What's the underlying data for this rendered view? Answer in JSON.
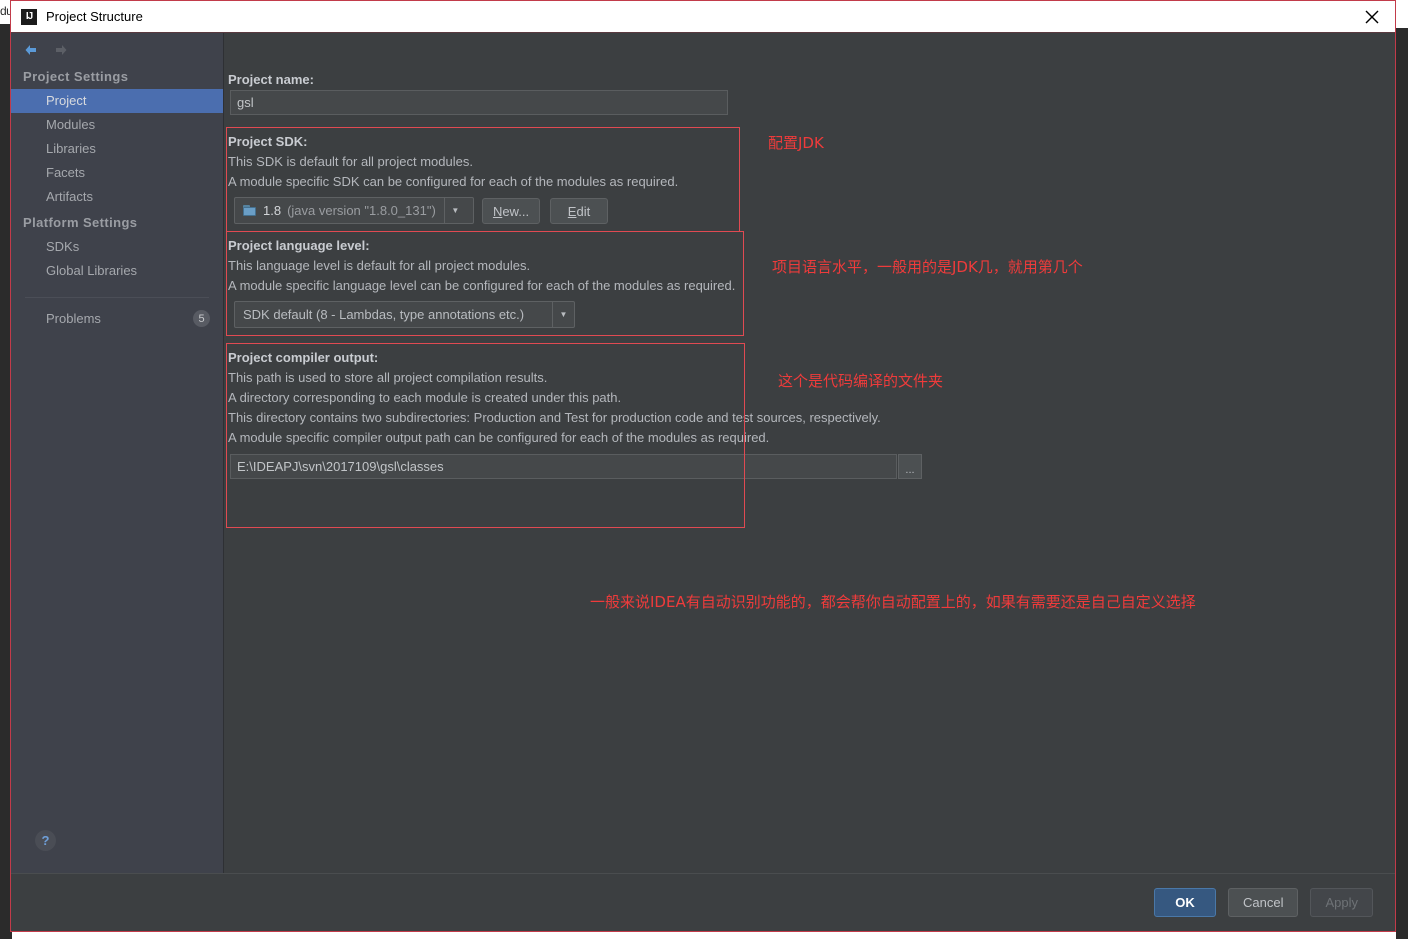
{
  "background": {
    "edge_text": "du"
  },
  "titlebar": {
    "app_icon": "intellij-idea-icon",
    "title": "Project Structure",
    "close_label": "close-icon"
  },
  "sidebar": {
    "nav": {
      "back": "back-arrow-icon",
      "forward": "forward-arrow-icon"
    },
    "groups": [
      {
        "header": "Project Settings",
        "items": [
          {
            "label": "Project",
            "selected": true
          },
          {
            "label": "Modules",
            "selected": false
          },
          {
            "label": "Libraries",
            "selected": false
          },
          {
            "label": "Facets",
            "selected": false
          },
          {
            "label": "Artifacts",
            "selected": false
          }
        ]
      },
      {
        "header": "Platform Settings",
        "items": [
          {
            "label": "SDKs",
            "selected": false
          },
          {
            "label": "Global Libraries",
            "selected": false
          }
        ]
      }
    ],
    "problems": {
      "label": "Problems",
      "count": "5"
    },
    "help": {
      "glyph": "?"
    }
  },
  "main": {
    "project_name": {
      "label": "Project name:",
      "value": "gsl",
      "placeholder": ""
    },
    "project_sdk": {
      "label": "Project SDK:",
      "desc": [
        "This SDK is default for all project modules.",
        "A module specific SDK can be configured for each of the modules as required."
      ],
      "combo_value": "1.8",
      "combo_detail": "(java version \"1.8.0_131\")",
      "new_button": "New...",
      "new_button_mnemonic": "N",
      "edit_button": "Edit",
      "edit_button_mnemonic": "E"
    },
    "language_level": {
      "label": "Project language level:",
      "desc": [
        "This language level is default for all project modules.",
        "A module specific language level can be configured for each of the modules as required."
      ],
      "combo_value": "SDK default (8 - Lambdas, type annotations etc.)"
    },
    "compiler_output": {
      "label": "Project compiler output:",
      "desc": [
        "This path is used to store all project compilation results.",
        "A directory corresponding to each module is created under this path.",
        "This directory contains two subdirectories: Production and Test for production code and test sources, respectively.",
        "A module specific compiler output path can be configured for each of the modules as required."
      ],
      "path_value": "E:\\IDEAPJ\\svn\\2017109\\gsl\\classes",
      "browse_label": "..."
    }
  },
  "annotations": [
    {
      "name": "annotation-configure-jdk",
      "text": "配置JDK"
    },
    {
      "name": "annotation-language-level",
      "text": "项目语言水平，一般用的是JDK几，就用第几个"
    },
    {
      "name": "annotation-compiler-output",
      "text": "这个是代码编译的文件夹"
    },
    {
      "name": "annotation-auto-detect",
      "text": "一般来说IDEA有自动识别功能的，都会帮你自动配置上的，如果有需要还是自己自定义选择"
    }
  ],
  "footer": {
    "ok": "OK",
    "cancel": "Cancel",
    "apply": "Apply"
  },
  "colors": {
    "accent_blue": "#4b6eaf",
    "panel_bg": "#3c3f41",
    "sidebar_bg": "#3f424b",
    "annotation_red": "#ef3b3b",
    "dialog_border": "#c23b4a"
  }
}
